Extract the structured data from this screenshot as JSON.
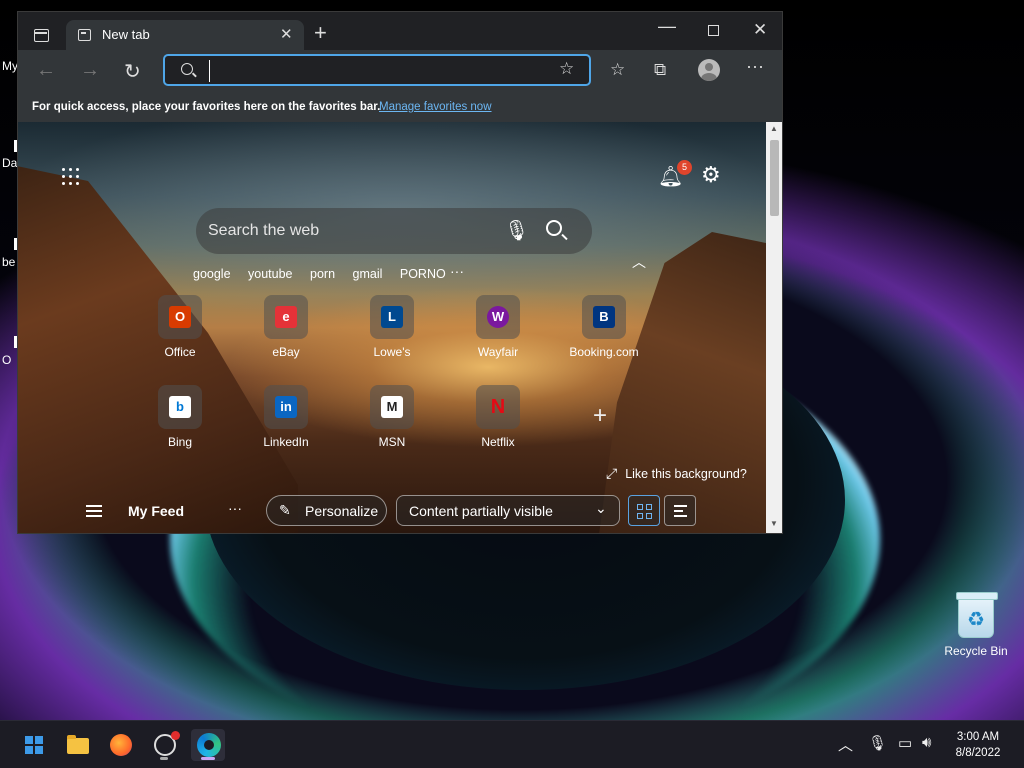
{
  "desktop": {
    "left_labels": [
      "My",
      "Da",
      "be",
      "O"
    ],
    "recycle_bin_label": "Recycle Bin"
  },
  "browser": {
    "tab": {
      "title": "New tab"
    },
    "address_bar": {
      "value": "",
      "placeholder": ""
    },
    "favorites_bar": {
      "message": "For quick access, place your favorites here on the favorites bar.",
      "link": "Manage favorites now"
    }
  },
  "newtab": {
    "notifications_count": "5",
    "search": {
      "placeholder": "Search the web"
    },
    "quick_links": [
      "google",
      "youtube",
      "porn",
      "gmail",
      "PORNO"
    ],
    "tiles": [
      {
        "label": "Office",
        "glyph": "O",
        "color": "#d83b01"
      },
      {
        "label": "eBay",
        "glyph": "e",
        "color": "#e53238"
      },
      {
        "label": "Lowe's",
        "glyph": "L",
        "color": "#004990"
      },
      {
        "label": "Wayfair",
        "glyph": "W",
        "color": "#7b189f"
      },
      {
        "label": "Booking.com",
        "glyph": "B",
        "color": "#003580"
      },
      {
        "label": "Bing",
        "glyph": "b",
        "color": "#0078d4"
      },
      {
        "label": "LinkedIn",
        "glyph": "in",
        "color": "#0a66c2"
      },
      {
        "label": "MSN",
        "glyph": "M",
        "color": "#222222"
      },
      {
        "label": "Netflix",
        "glyph": "N",
        "color": "#e50914"
      }
    ],
    "background_prompt": "Like this background?",
    "feed": {
      "title": "My Feed",
      "personalize": "Personalize",
      "visibility": "Content partially visible"
    }
  },
  "taskbar": {
    "time": "3:00 AM",
    "date": "8/8/2022"
  }
}
